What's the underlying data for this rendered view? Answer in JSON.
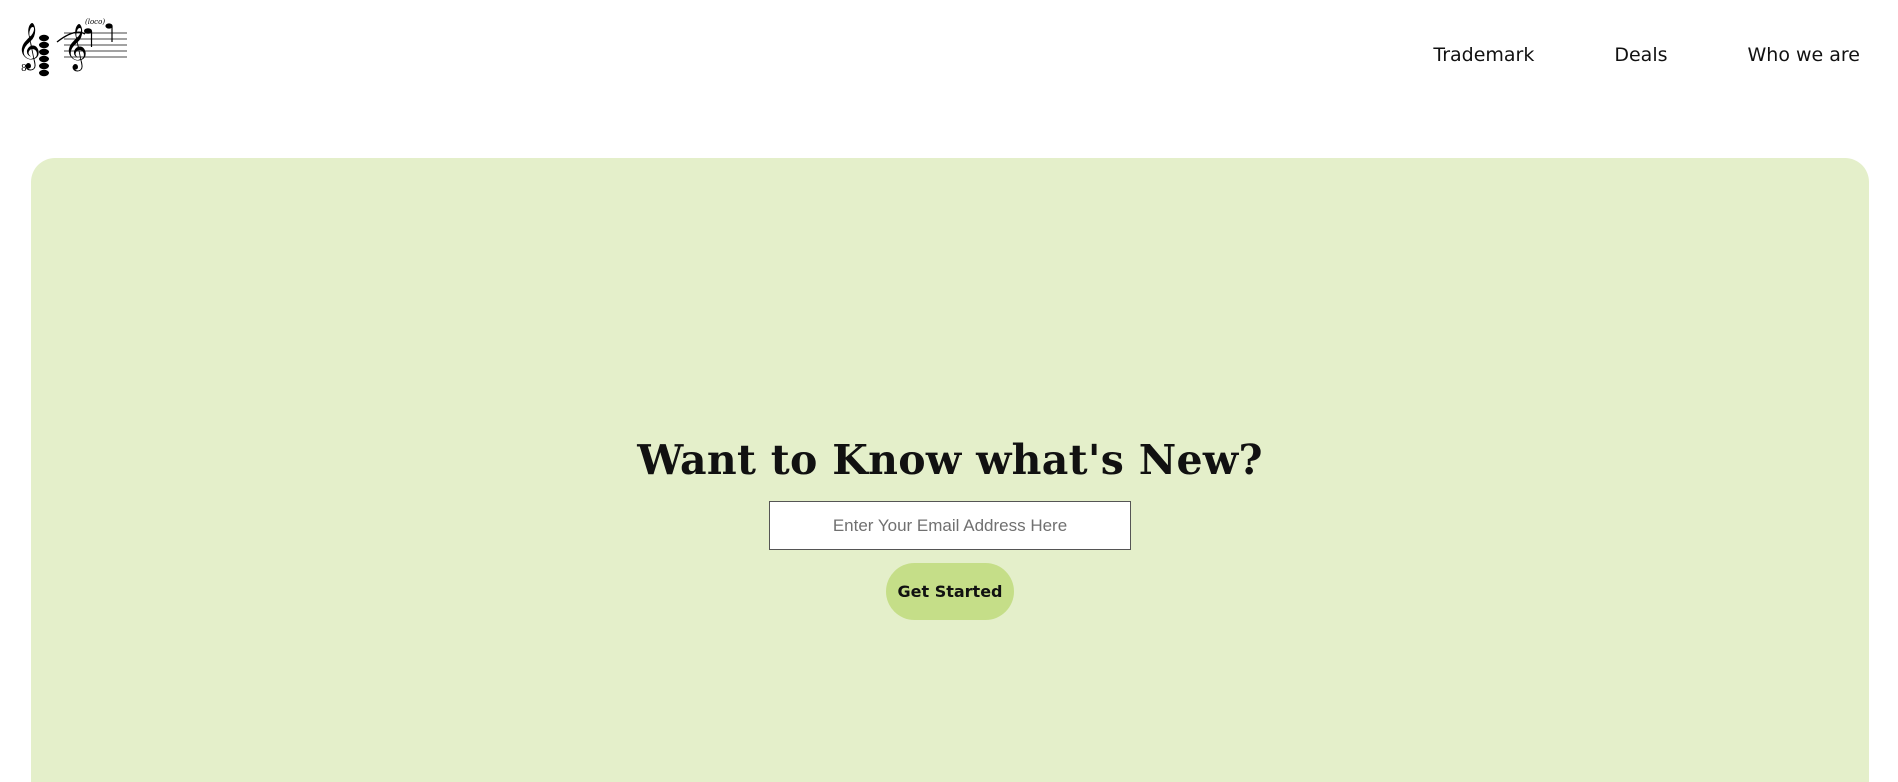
{
  "nav": {
    "items": [
      {
        "label": "Trademark"
      },
      {
        "label": "Deals"
      },
      {
        "label": "Who we are"
      }
    ]
  },
  "hero": {
    "title": "Want to Know what's New?",
    "email_placeholder": "Enter Your Email Address Here",
    "cta_label": "Get Started"
  },
  "logo": {
    "annotation": "(loco)"
  },
  "colors": {
    "hero_bg": "#e4efca",
    "cta_bg": "#c5de88"
  }
}
